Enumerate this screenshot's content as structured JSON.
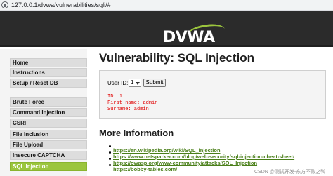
{
  "browser": {
    "url": "127.0.0.1/dvwa/vulnerabilities/sqli/#"
  },
  "header": {
    "logo_text": "DVWA"
  },
  "sidebar": {
    "items": [
      {
        "label": "Home",
        "active": false
      },
      {
        "label": "Instructions",
        "active": false
      },
      {
        "label": "Setup / Reset DB",
        "active": false
      },
      {
        "label": "Brute Force",
        "active": false
      },
      {
        "label": "Command Injection",
        "active": false
      },
      {
        "label": "CSRF",
        "active": false
      },
      {
        "label": "File Inclusion",
        "active": false
      },
      {
        "label": "File Upload",
        "active": false
      },
      {
        "label": "Insecure CAPTCHA",
        "active": false
      },
      {
        "label": "SQL Injection",
        "active": true
      }
    ],
    "active_color": "#9bc53d"
  },
  "main": {
    "title": "Vulnerability: SQL Injection",
    "form": {
      "user_id_label": "User ID:",
      "user_id_value": "1",
      "submit_label": "Submit"
    },
    "result": {
      "id_line": "ID: 1",
      "first_name_line": "First name: admin",
      "surname_line": "Surname: admin",
      "color": "#e00000"
    },
    "more_info": {
      "title": "More Information",
      "links": [
        "https://en.wikipedia.org/wiki/SQL_injection",
        "https://www.netsparker.com/blog/web-security/sql-injection-cheat-sheet/",
        "https://owasp.org/www-community/attacks/SQL_Injection",
        "https://bobby-tables.com/"
      ]
    }
  },
  "watermark": "CSDN @测试开发-东方不败之鸭"
}
